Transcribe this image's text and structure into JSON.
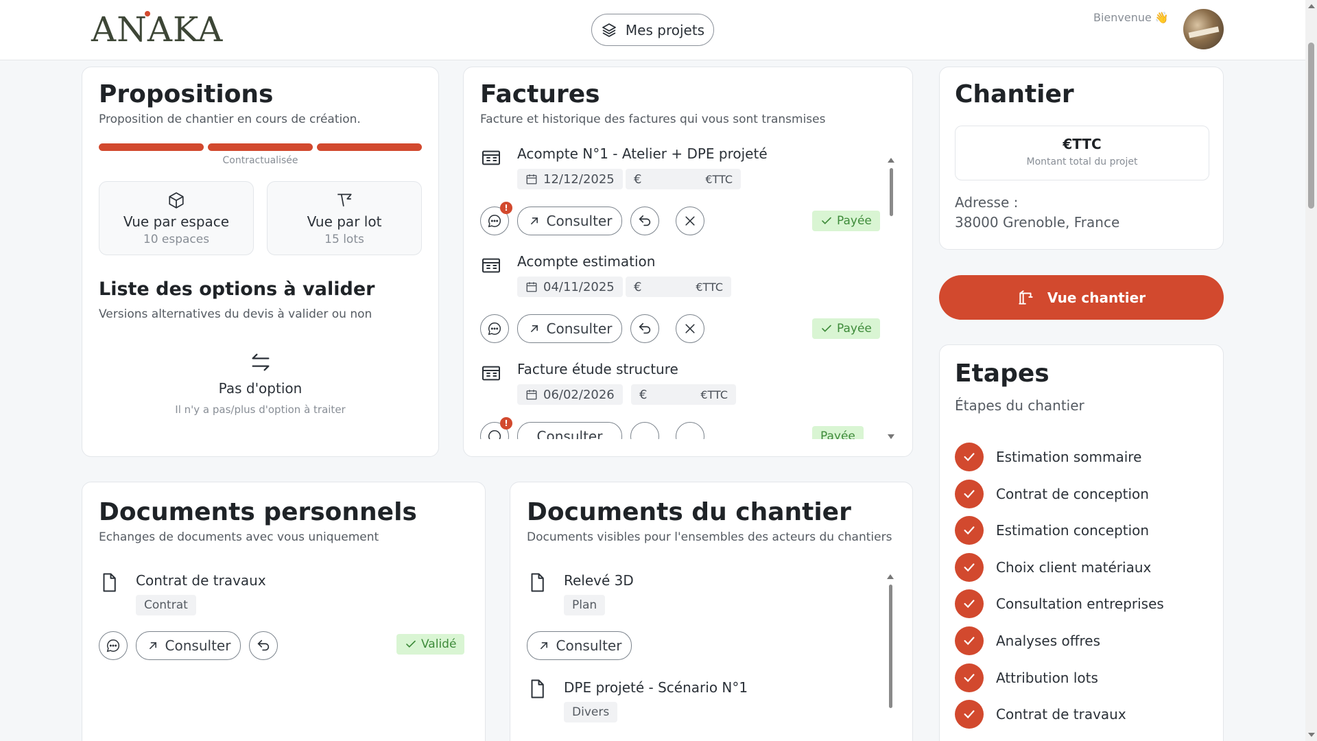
{
  "header": {
    "logo": "ANAKA",
    "projects_button": "Mes projets",
    "welcome": "Bienvenue 👋"
  },
  "propositions": {
    "title": "Propositions",
    "subtitle": "Proposition de chantier en cours de création.",
    "progress_label": "Contractualisée",
    "view_space": {
      "label": "Vue par espace",
      "count": "10 espaces"
    },
    "view_lot": {
      "label": "Vue par lot",
      "count": "15 lots"
    },
    "options_title": "Liste des options à valider",
    "options_subtitle": "Versions alternatives du devis à valider ou non",
    "empty_title": "Pas d'option",
    "empty_subtitle": "Il n'y a pas/plus d'option à traiter"
  },
  "factures": {
    "title": "Factures",
    "subtitle": "Facture et historique des factures qui vous sont transmises",
    "consult_label": "Consulter",
    "items": [
      {
        "name": "Acompte N°1 - Atelier + DPE projeté",
        "date": "12/12/2025",
        "currency": "€",
        "amount_suffix": "€TTC",
        "status": "Payée"
      },
      {
        "name": "Acompte estimation",
        "date": "04/11/2025",
        "currency": "€",
        "amount_suffix": "€TTC",
        "status": "Payée"
      },
      {
        "name": "Facture étude structure",
        "date": "06/02/2026",
        "currency": "€",
        "amount_suffix": "€TTC",
        "status": "Payée"
      }
    ]
  },
  "chantier": {
    "title": "Chantier",
    "amount": "€TTC",
    "amount_caption": "Montant total du projet",
    "address_label": "Adresse :",
    "address": "38000 Grenoble, France",
    "view_button": "Vue chantier"
  },
  "etapes": {
    "title": "Etapes",
    "subtitle": "Étapes du chantier",
    "steps": [
      "Estimation sommaire",
      "Contrat de conception",
      "Estimation conception",
      "Choix client matériaux",
      "Consultation entreprises",
      "Analyses offres",
      "Attribution lots",
      "Contrat de travaux"
    ]
  },
  "docs_perso": {
    "title": "Documents personnels",
    "subtitle": "Echanges de documents avec vous uniquement",
    "doc_name": "Contrat de travaux",
    "doc_tag": "Contrat",
    "consult_label": "Consulter",
    "status": "Validé"
  },
  "docs_chantier": {
    "title": "Documents du chantier",
    "subtitle": "Documents visibles pour l'ensembles des acteurs du chantiers",
    "consult_label": "Consulter",
    "items": [
      {
        "name": "Relevé 3D",
        "tag": "Plan"
      },
      {
        "name": "DPE projeté - Scénario N°1",
        "tag": "Divers"
      }
    ]
  },
  "colors": {
    "accent": "#d2492e",
    "success_bg": "#d9f5d3",
    "success_text": "#3e8b3a"
  }
}
